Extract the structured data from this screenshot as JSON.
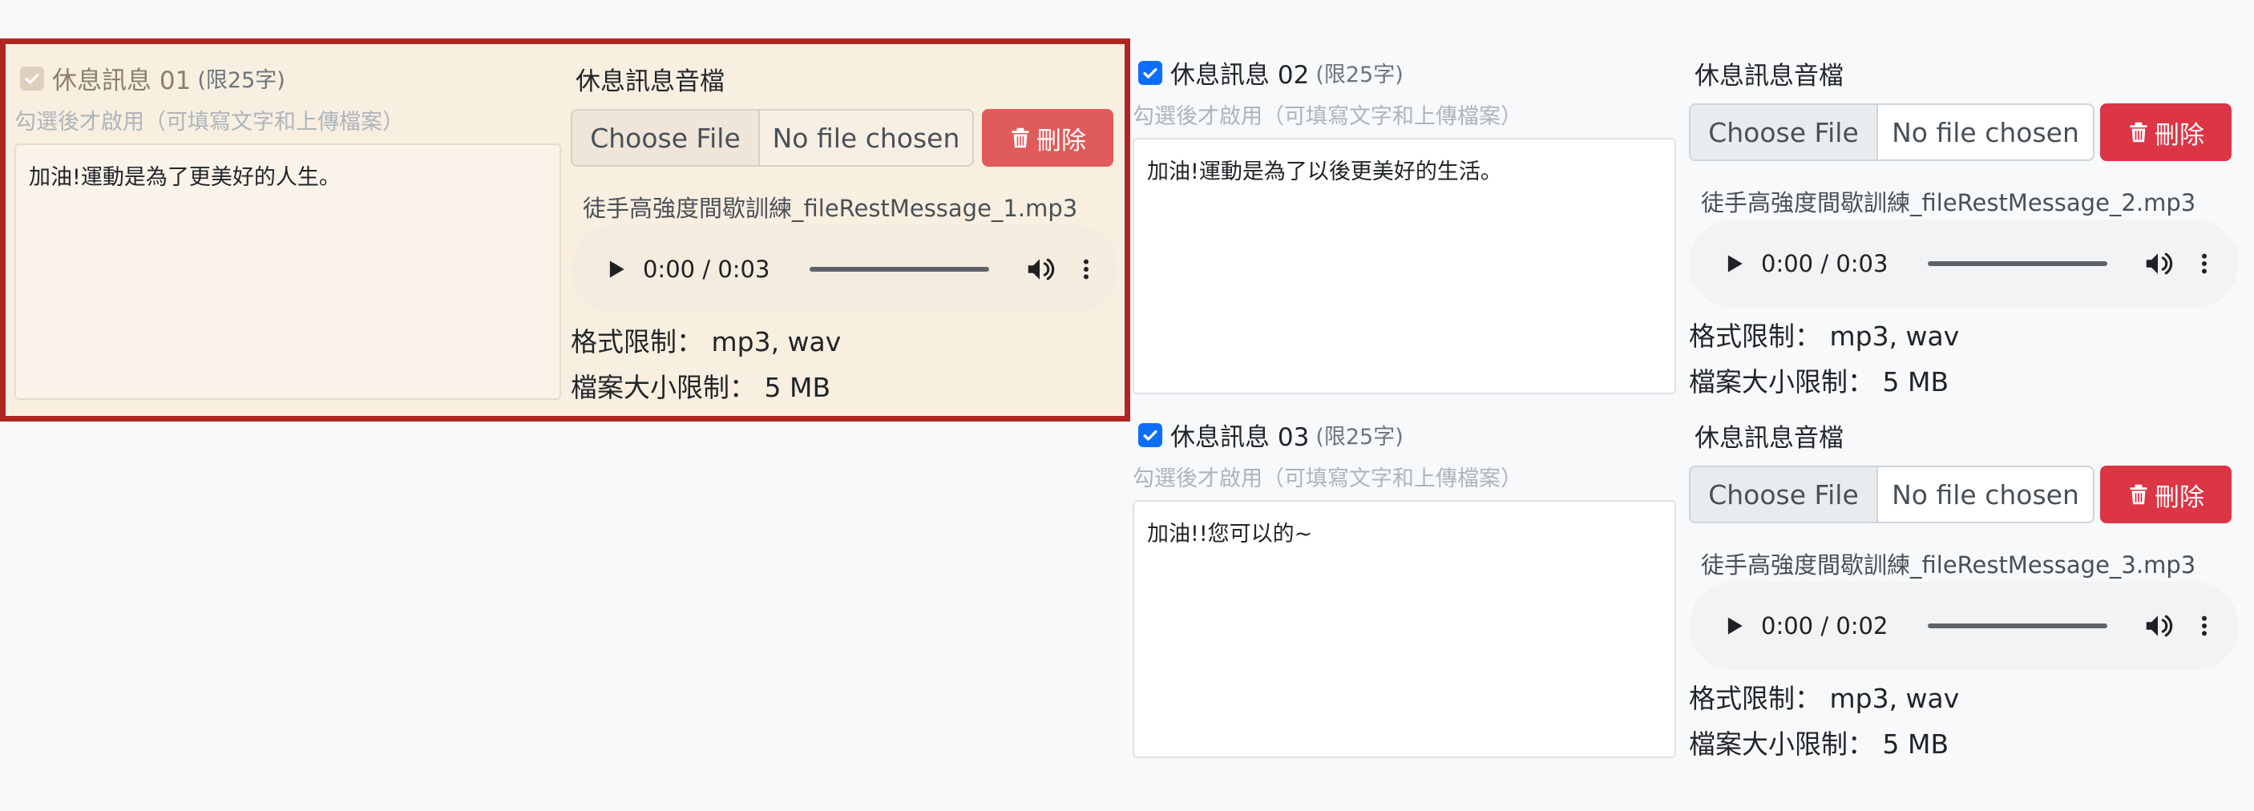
{
  "messages": [
    {
      "title": "休息訊息 01",
      "limit": "(限25字)",
      "hint": "勾選後才啟用（可填寫文字和上傳檔案）",
      "text": "加油!運動是為了更美好的人生。",
      "checked": true,
      "disabled": true,
      "highlighted": true,
      "audio_label": "休息訊息音檔",
      "choose_label": "Choose File",
      "no_file_label": "No file chosen",
      "delete_label": "刪除",
      "filename": "徒手高強度間歇訓練_fileRestMessage_1.mp3",
      "audio_time": "0:00 / 0:03",
      "format_limit": "格式限制： mp3, wav",
      "size_limit": "檔案大小限制： 5 MB"
    },
    {
      "title": "休息訊息 02",
      "limit": "(限25字)",
      "hint": "勾選後才啟用（可填寫文字和上傳檔案）",
      "text": "加油!運動是為了以後更美好的生活。",
      "checked": true,
      "disabled": false,
      "highlighted": false,
      "audio_label": "休息訊息音檔",
      "choose_label": "Choose File",
      "no_file_label": "No file chosen",
      "delete_label": "刪除",
      "filename": "徒手高強度間歇訓練_fileRestMessage_2.mp3",
      "audio_time": "0:00 / 0:03",
      "format_limit": "格式限制： mp3, wav",
      "size_limit": "檔案大小限制： 5 MB"
    },
    {
      "title": "休息訊息 03",
      "limit": "(限25字)",
      "hint": "勾選後才啟用（可填寫文字和上傳檔案）",
      "text": "加油!!您可以的~",
      "checked": true,
      "disabled": false,
      "highlighted": false,
      "audio_label": "休息訊息音檔",
      "choose_label": "Choose File",
      "no_file_label": "No file chosen",
      "delete_label": "刪除",
      "filename": "徒手高強度間歇訓練_fileRestMessage_3.mp3",
      "audio_time": "0:00 / 0:02",
      "format_limit": "格式限制： mp3, wav",
      "size_limit": "檔案大小限制： 5 MB"
    }
  ],
  "colors": {
    "highlight_border": "#b02521",
    "highlight_bg": "#f9efe0",
    "checkbox_on": "#0d6efd",
    "delete_button": "#dc3545"
  },
  "icons": {
    "checkbox": "check-icon",
    "delete": "trash-icon",
    "play": "play-icon",
    "volume": "volume-icon",
    "more": "more-vertical-icon"
  }
}
